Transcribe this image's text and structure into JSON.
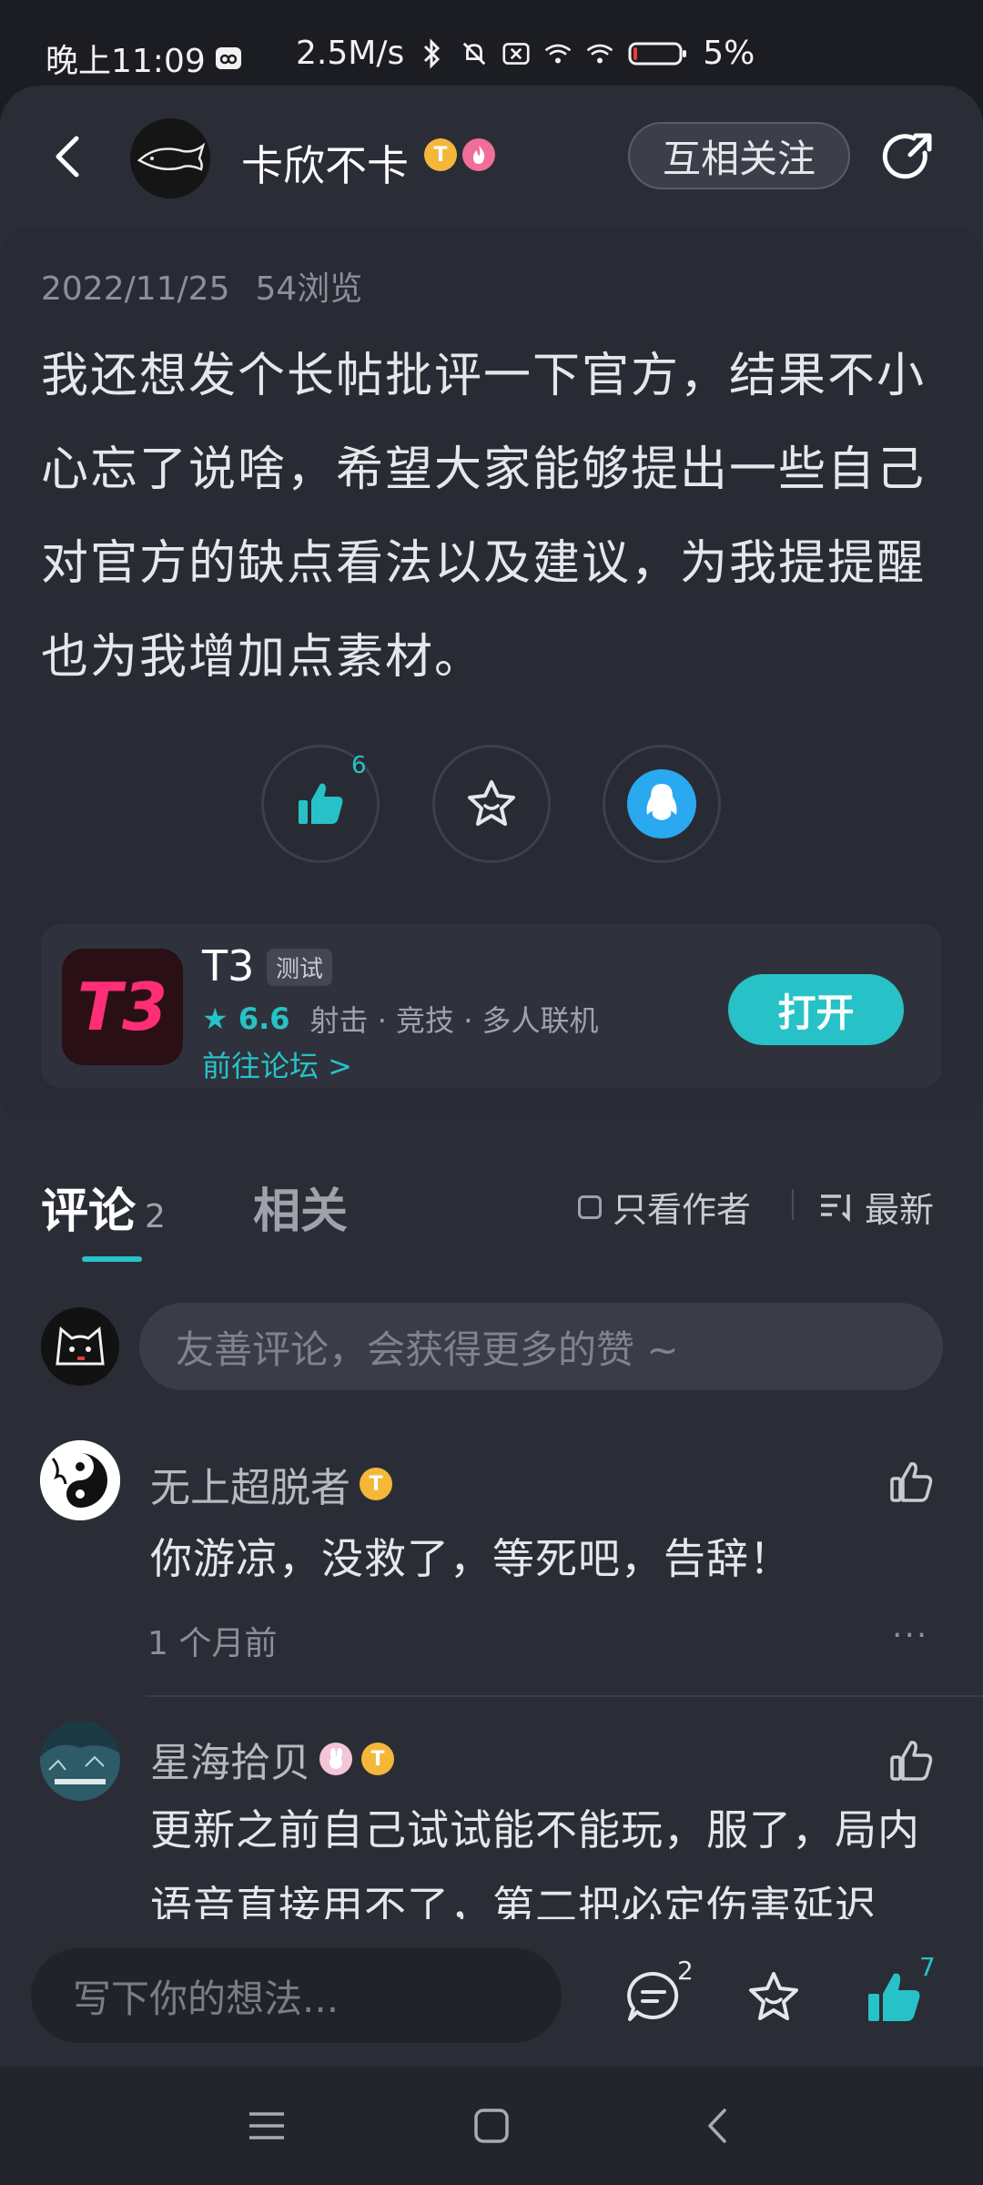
{
  "status_bar": {
    "time": "晚上11:09",
    "network_speed": "2.5M/s",
    "battery": "5%"
  },
  "header": {
    "author_name": "卡欣不卡",
    "badge_t": "T",
    "follow_label": "互相关注"
  },
  "post": {
    "date": "2022/11/25",
    "views": "54浏览",
    "body": "我还想发个长帖批评一下官方，结果不小心忘了说啥，希望大家能够提出一些自己对官方的缺点看法以及建议，为我提提醒也为我增加点素材。",
    "like_count": "6"
  },
  "game": {
    "logo_text": "T3",
    "title": "T3",
    "tag": "测试",
    "rating": "6.6",
    "categories": "射击 · 竞技 · 多人联机",
    "forum_link": "前往论坛 >",
    "open_label": "打开"
  },
  "tabs": {
    "comments_label": "评论",
    "comments_count": "2",
    "related_label": "相关",
    "author_only_label": "只看作者",
    "sort_label": "最新"
  },
  "comment_input_placeholder": "友善评论，会获得更多的赞 ~",
  "comments": [
    {
      "name": "无上超脱者",
      "badge": "T",
      "text": "你游凉，没救了，等死吧，告辞！",
      "time": "1 个月前",
      "more": "···"
    },
    {
      "name": "星海拾贝",
      "badge": "T",
      "text": "更新之前自己试试能不能玩，服了，局内语音直接用不了，第二把必定伤害延迟"
    }
  ],
  "bottom_bar": {
    "placeholder": "写下你的想法...",
    "comment_count": "2",
    "like_count": "7"
  },
  "colors": {
    "accent": "#27c2c7",
    "background": "#2b2d36",
    "qq_blue": "#2aa8f0"
  }
}
